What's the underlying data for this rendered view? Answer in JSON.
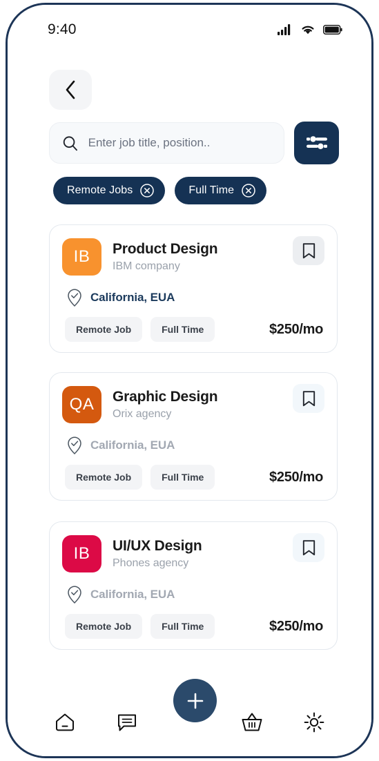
{
  "status_bar": {
    "time": "9:40",
    "icons": [
      "signal-icon",
      "wifi-icon",
      "battery-icon"
    ]
  },
  "header": {
    "back_label": "chevron-left-icon"
  },
  "search": {
    "placeholder": "Enter job title, position..",
    "value": "",
    "icon": "search-icon",
    "filter_icon": "sliders-icon"
  },
  "filter_chips": [
    {
      "label": "Remote Jobs",
      "remove_icon": "close-circle-icon"
    },
    {
      "label": "Full Time",
      "remove_icon": "close-circle-icon"
    }
  ],
  "accent": {
    "navy": "#153254",
    "fab_navy": "#2b4a6b",
    "tag_bg": "#f3f4f6"
  },
  "jobs": [
    {
      "logo_text": "IB",
      "logo_color": "#f8922e",
      "title": "Product Design",
      "company": "IBM company",
      "location": "California, EUA",
      "location_color": "#1b3a5c",
      "location_icon": "verified-location-icon",
      "bookmark_icon": "bookmark-icon",
      "bookmark_bg": "#eceef1",
      "tags": [
        "Remote Job",
        "Full Time"
      ],
      "price": "$250/mo"
    },
    {
      "logo_text": "QA",
      "logo_color": "#d4590f",
      "title": "Graphic Design",
      "company": "Orix agency",
      "location": "California, EUA",
      "location_color": "#a2a8b2",
      "location_icon": "verified-location-icon",
      "bookmark_icon": "bookmark-icon",
      "bookmark_bg": "#f2f7fb",
      "tags": [
        "Remote Job",
        "Full Time"
      ],
      "price": "$250/mo"
    },
    {
      "logo_text": "IB",
      "logo_color": "#dc0a46",
      "title": "UI/UX Design",
      "company": "Phones agency",
      "location": "California, EUA",
      "location_color": "#a2a8b2",
      "location_icon": "verified-location-icon",
      "bookmark_icon": "bookmark-icon",
      "bookmark_bg": "#f2f7fb",
      "tags": [
        "Remote Job",
        "Full Time"
      ],
      "price": "$250/mo"
    }
  ],
  "bottom_nav": {
    "items": [
      {
        "name": "home",
        "icon": "home-icon"
      },
      {
        "name": "messages",
        "icon": "chat-bubble-icon"
      },
      {
        "name": "cart",
        "icon": "basket-icon"
      },
      {
        "name": "settings",
        "icon": "gear-icon"
      }
    ],
    "fab_icon": "plus-icon"
  }
}
